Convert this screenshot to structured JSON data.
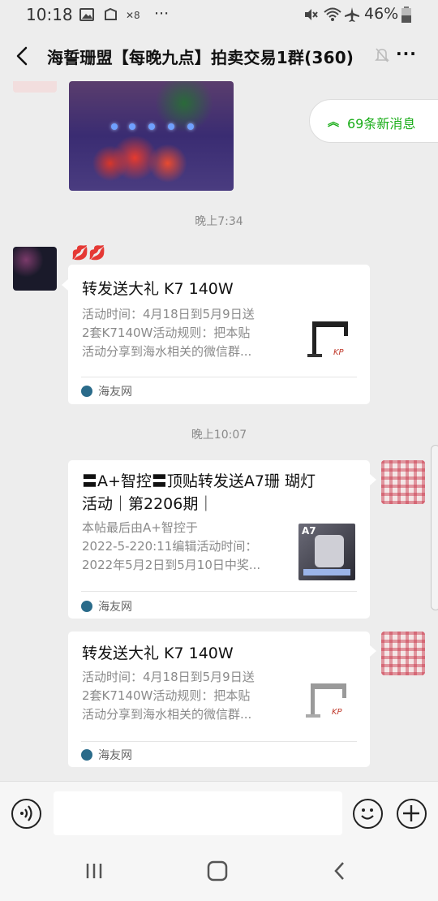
{
  "status_bar": {
    "time": "10:18",
    "battery": "46%"
  },
  "header": {
    "title": "海誓珊盟【每晚九点】拍卖交易1群(360)",
    "more": "···"
  },
  "new_messages": {
    "label": "69条新消息"
  },
  "messages": {
    "timestamp_1": "晚上7:34",
    "sender_emoji": "💋💋",
    "card_1": {
      "title": "转发送大礼 K7 140W",
      "desc_lines": [
        "活动时间：4月18日到5月9日送",
        "2套K7140W活动规则：把本贴",
        "活动分享到海水相关的微信群..."
      ],
      "source": "海友网"
    },
    "timestamp_2": "晚上10:07",
    "card_2": {
      "title_lines": [
        "〓A+智控〓顶贴转发送A7珊 瑚灯",
        "活动｜第2206期｜"
      ],
      "desc_lines": [
        "本帖最后由A+智控于",
        "2022-5-220:11编辑活动时间：",
        "2022年5月2日到5月10日中奖..."
      ],
      "thumb_label": "A7",
      "source": "海友网"
    },
    "card_3": {
      "title": "转发送大礼 K7 140W",
      "desc_lines": [
        "活动时间：4月18日到5月9日送",
        "2套K7140W活动规则：把本贴",
        "活动分享到海水相关的微信群..."
      ],
      "source": "海友网"
    }
  },
  "input": {
    "placeholder": "",
    "value": ""
  },
  "colors": {
    "accent_green": "#1aad19",
    "background": "#ededed",
    "card": "#ffffff"
  },
  "icons": {
    "status": [
      "gallery-icon",
      "screenshot-icon",
      "data-saver-icon",
      "mute-icon",
      "wifi-icon",
      "airplane-icon",
      "battery-icon"
    ],
    "header": [
      "back-icon",
      "bell-off-icon",
      "more-icon"
    ],
    "input": [
      "voice-icon",
      "emoji-icon",
      "plus-icon"
    ],
    "nav": [
      "recent-apps-icon",
      "home-icon",
      "nav-back-icon"
    ]
  }
}
